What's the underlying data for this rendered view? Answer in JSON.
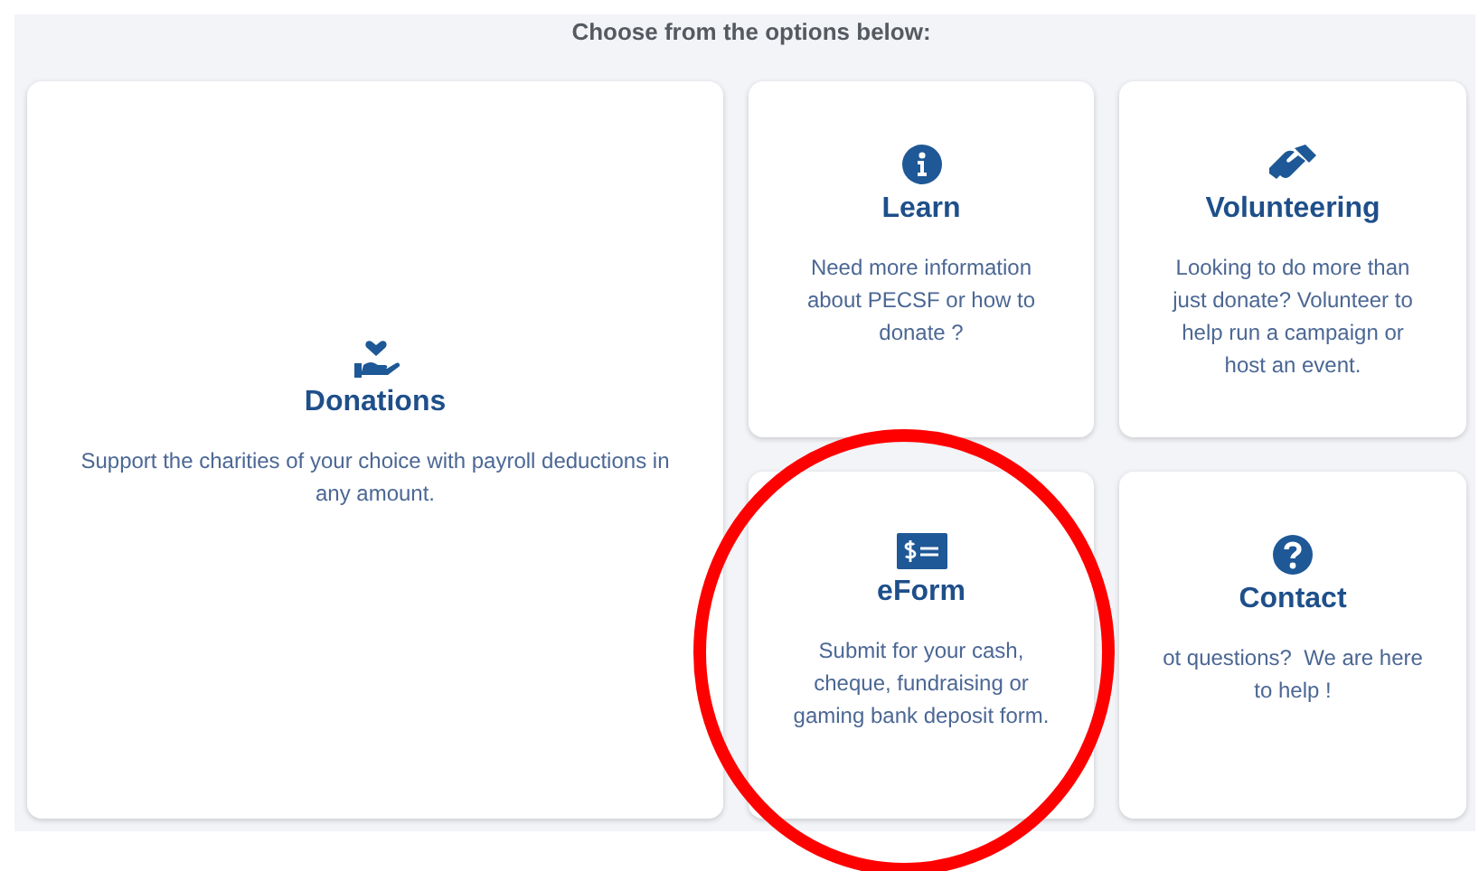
{
  "heading": "Choose from the options below:",
  "cards": [
    {
      "kind": "donate",
      "title": "Donations",
      "text": "Support the charities of your choice with payroll deductions in any amount."
    },
    {
      "kind": "info",
      "title": "Learn",
      "text": "Need more information about PECSF or how to donate ?"
    },
    {
      "kind": "volunteer",
      "title": "Volunteering",
      "text": "Looking to do more than just donate? Volunteer to help run a campaign or host an event."
    },
    {
      "kind": "form",
      "title": "eForm",
      "text": "Submit for your cash, cheque, fundraising or gaming bank deposit form."
    },
    {
      "kind": "help",
      "title": "Contact",
      "text": "ot questions?  We are here to help !"
    }
  ],
  "annotation": {
    "kind": "circle"
  }
}
